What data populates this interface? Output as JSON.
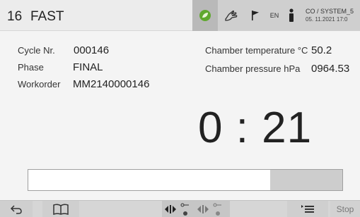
{
  "header": {
    "program_number": "16",
    "program_name": "FAST",
    "language": "EN",
    "user": "CO / SYSTEM_5",
    "datetime": "05. 11.2021  17:0"
  },
  "cycle": {
    "cycle_nr_label": "Cycle Nr.",
    "cycle_nr_value": "000146",
    "phase_label": "Phase",
    "phase_value": "FINAL",
    "workorder_label": "Workorder",
    "workorder_value": "MM2140000146"
  },
  "chamber": {
    "temperature_label": "Chamber temperature °C",
    "temperature_value": "50.2",
    "pressure_label": "Chamber pressure hPa",
    "pressure_value": "0964.53"
  },
  "timer": {
    "value": "0 : 21"
  },
  "progress": {
    "fraction": 0.77
  },
  "footer": {
    "stop_label": "Stop"
  },
  "icons": {
    "status": [
      "leaf-icon",
      "hand-icon",
      "flag-icon",
      "user-icon"
    ],
    "footer": [
      "back-icon",
      "manual-book-icon",
      "door-control-icon",
      "key-icon",
      "menu-list-icon"
    ]
  },
  "colors": {
    "leaf_green": "#5fa82e",
    "progress_fill": "#ffffff",
    "progress_track": "#cdcdcd"
  }
}
